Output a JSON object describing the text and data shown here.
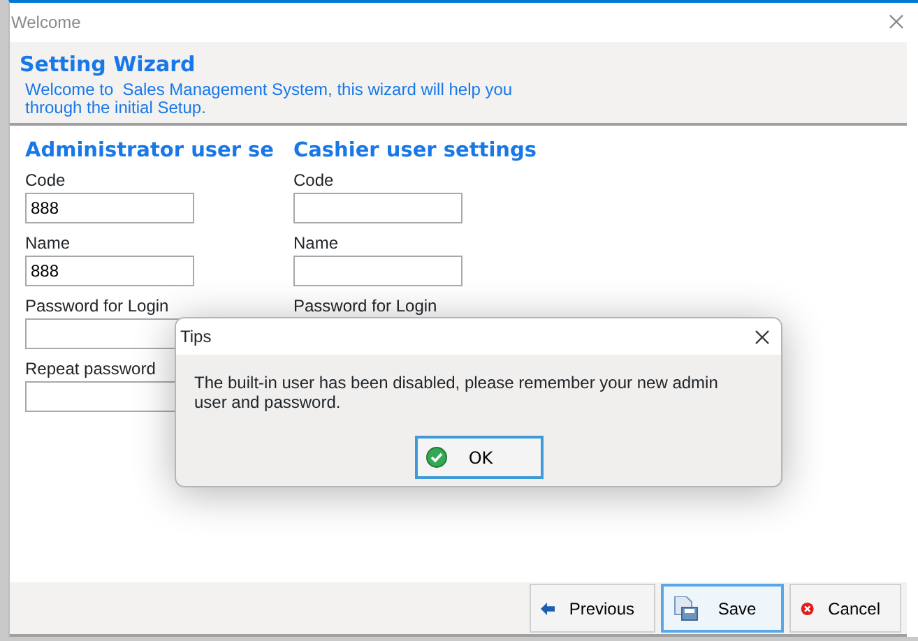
{
  "window": {
    "title": "Welcome"
  },
  "header": {
    "title": "Setting Wizard",
    "description": "Welcome to  Sales Management System, this wizard will help you through the initial Setup."
  },
  "sections": [
    {
      "title": "Administrator user se",
      "fields": [
        {
          "kind": "text",
          "label": "Code",
          "value": "888"
        },
        {
          "kind": "text",
          "label": "Name",
          "value": "888"
        },
        {
          "kind": "text",
          "label": "Password for Login"
        },
        {
          "kind": "text",
          "label": "Repeat password"
        }
      ]
    },
    {
      "title": "Cashier user settings",
      "fields": [
        {
          "kind": "text",
          "label": "Code"
        },
        {
          "kind": "text",
          "label": "Name"
        },
        {
          "kind": "label",
          "label": "Password for Login"
        }
      ]
    }
  ],
  "buttons": [
    {
      "label": "Previous",
      "kind": "arrow",
      "focused": false
    },
    {
      "label": "Save",
      "kind": "save",
      "focused": true
    },
    {
      "label": "Cancel",
      "kind": "cancel",
      "focused": false
    }
  ],
  "dialog": {
    "title": "Tips",
    "message": "The built-in user has been disabled, please remember your new admin user and password.",
    "button": {
      "label": "OK",
      "kind": "check",
      "focused": true
    }
  }
}
